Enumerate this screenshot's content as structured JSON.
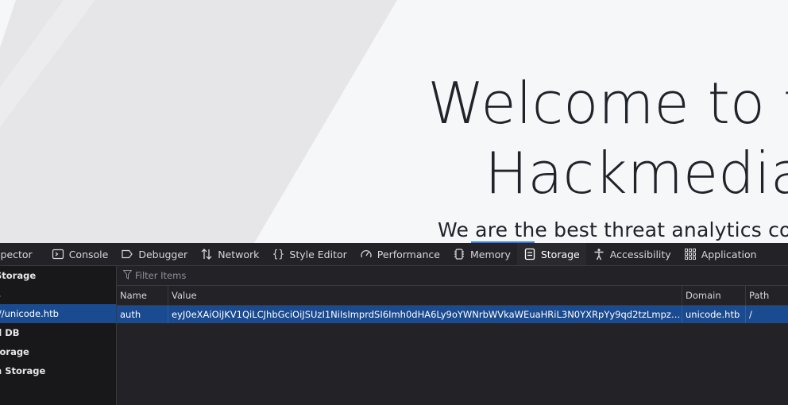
{
  "page": {
    "hero_line1": "Welcome to t",
    "hero_line2": "Hackmedia",
    "subtitle": "We are the best threat analytics compa"
  },
  "devtools": {
    "tabs": [
      {
        "label": "spector",
        "icon": "inspector-icon"
      },
      {
        "label": "Console",
        "icon": "console-icon"
      },
      {
        "label": "Debugger",
        "icon": "debugger-icon"
      },
      {
        "label": "Network",
        "icon": "network-icon"
      },
      {
        "label": "Style Editor",
        "icon": "style-editor-icon"
      },
      {
        "label": "Performance",
        "icon": "performance-icon"
      },
      {
        "label": "Memory",
        "icon": "memory-icon"
      },
      {
        "label": "Storage",
        "icon": "storage-icon"
      },
      {
        "label": "Accessibility",
        "icon": "accessibility-icon"
      },
      {
        "label": "Application",
        "icon": "application-icon"
      }
    ],
    "sidebar": [
      "Storage",
      "s",
      "://unicode.htb",
      "d DB",
      "torage",
      "n Storage"
    ],
    "filter_placeholder": "Filter Items",
    "columns": {
      "name": "Name",
      "value": "Value",
      "domain": "Domain",
      "path": "Path"
    },
    "row": {
      "name": "auth",
      "value": "eyJ0eXAiOiJKV1QiLCJhbGciOiJSUzI1NiIsImprdSI6Imh0dHA6Ly9oYWNrbWVkaWEuaHRiL3N0YXRpYy9qd2tzLmpzb24ifQ.eyJ1c2V…",
      "domain": "unicode.htb",
      "path": "/"
    },
    "accent": "#2f7bf5",
    "selection_color": "#1a4a8f"
  }
}
